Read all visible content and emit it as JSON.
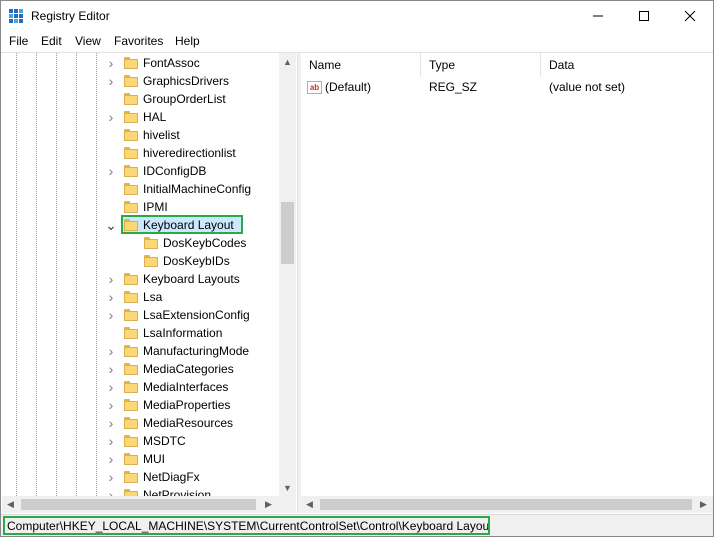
{
  "window": {
    "title": "Registry Editor",
    "app_icon": "registry-editor-icon"
  },
  "controls": {
    "minimize": "minimize-icon",
    "maximize": "maximize-icon",
    "close": "close-icon"
  },
  "menu": [
    "File",
    "Edit",
    "View",
    "Favorites",
    "Help"
  ],
  "tree": {
    "items": [
      {
        "label": "FontAssoc",
        "expander": "collapsed",
        "indent": 0
      },
      {
        "label": "GraphicsDrivers",
        "expander": "collapsed",
        "indent": 0
      },
      {
        "label": "GroupOrderList",
        "expander": "none",
        "indent": 0
      },
      {
        "label": "HAL",
        "expander": "collapsed",
        "indent": 0
      },
      {
        "label": "hivelist",
        "expander": "none",
        "indent": 0
      },
      {
        "label": "hiveredirectionlist",
        "expander": "none",
        "indent": 0
      },
      {
        "label": "IDConfigDB",
        "expander": "collapsed",
        "indent": 0
      },
      {
        "label": "InitialMachineConfig",
        "expander": "none",
        "indent": 0
      },
      {
        "label": "IPMI",
        "expander": "none",
        "indent": 0
      },
      {
        "label": "Keyboard Layout",
        "expander": "expanded",
        "indent": 0,
        "selected": true
      },
      {
        "label": "DosKeybCodes",
        "expander": "none",
        "indent": 1
      },
      {
        "label": "DosKeybIDs",
        "expander": "none",
        "indent": 1
      },
      {
        "label": "Keyboard Layouts",
        "expander": "collapsed",
        "indent": 0
      },
      {
        "label": "Lsa",
        "expander": "collapsed",
        "indent": 0
      },
      {
        "label": "LsaExtensionConfig",
        "expander": "collapsed",
        "indent": 0
      },
      {
        "label": "LsaInformation",
        "expander": "none",
        "indent": 0
      },
      {
        "label": "ManufacturingMode",
        "expander": "collapsed",
        "indent": 0
      },
      {
        "label": "MediaCategories",
        "expander": "collapsed",
        "indent": 0
      },
      {
        "label": "MediaInterfaces",
        "expander": "collapsed",
        "indent": 0
      },
      {
        "label": "MediaProperties",
        "expander": "collapsed",
        "indent": 0
      },
      {
        "label": "MediaResources",
        "expander": "collapsed",
        "indent": 0
      },
      {
        "label": "MSDTC",
        "expander": "collapsed",
        "indent": 0
      },
      {
        "label": "MUI",
        "expander": "collapsed",
        "indent": 0
      },
      {
        "label": "NetDiagFx",
        "expander": "collapsed",
        "indent": 0
      },
      {
        "label": "NetProvision",
        "expander": "collapsed",
        "indent": 0
      }
    ]
  },
  "list": {
    "columns": [
      "Name",
      "Type",
      "Data"
    ],
    "rows": [
      {
        "name": "(Default)",
        "type": "REG_SZ",
        "data": "(value not set)",
        "icon": "string-value-icon"
      }
    ]
  },
  "status": {
    "path": "Computer\\HKEY_LOCAL_MACHINE\\SYSTEM\\CurrentControlSet\\Control\\Keyboard Layout"
  },
  "colors": {
    "highlight": "#2aa84a",
    "selection": "#cce8ff"
  }
}
